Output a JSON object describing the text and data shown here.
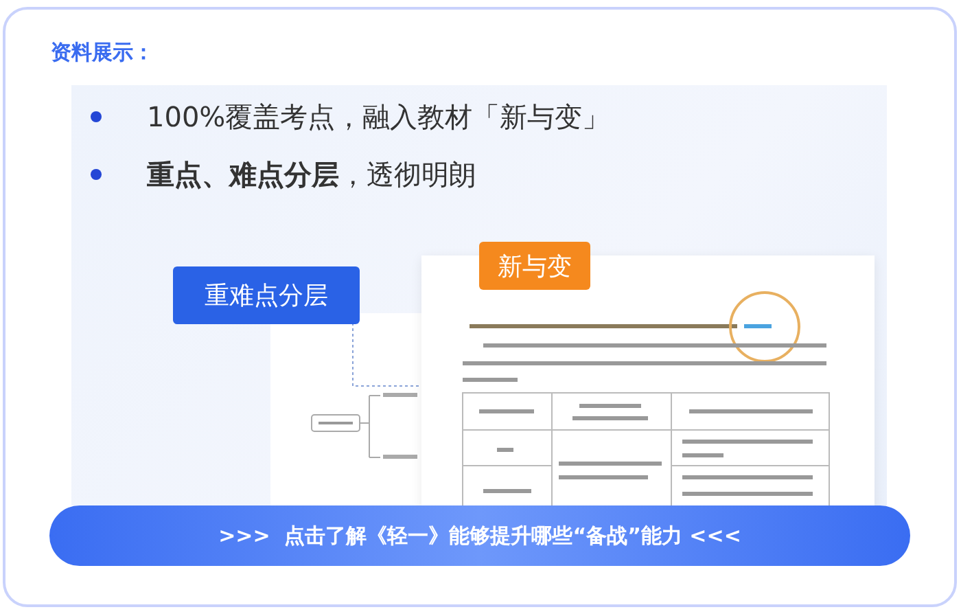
{
  "section_title": "资料展示：",
  "showcase": {
    "bullets": [
      {
        "text": "100%覆盖考点，融入教材「新与变」"
      },
      {
        "text": "**重点、难点分层**，透彻明朗"
      }
    ],
    "labels": [
      {
        "kind": "blue",
        "text": "重难点分层"
      },
      {
        "kind": "orange",
        "text": "新与变"
      }
    ]
  },
  "cta_button": ">>>  点击了解《轻一》能够提升哪些“备战”能力 <<<"
}
